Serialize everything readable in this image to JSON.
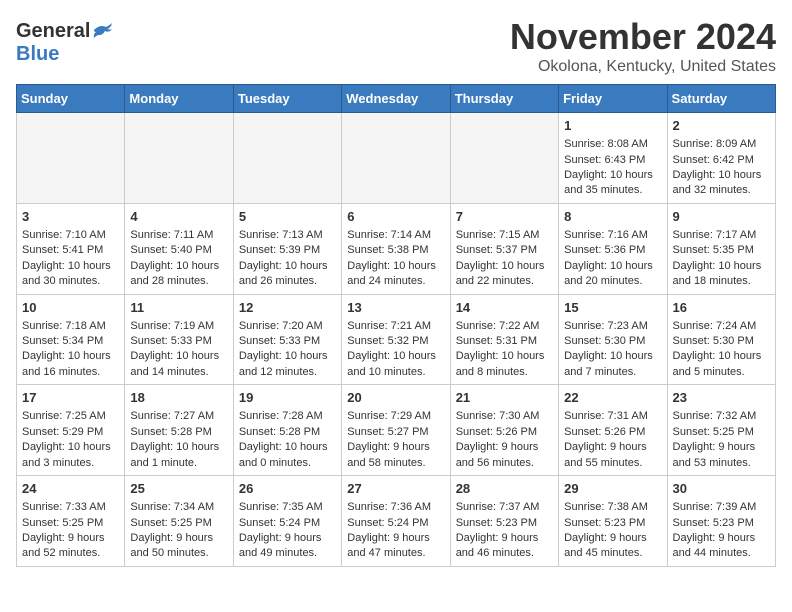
{
  "header": {
    "logo_general": "General",
    "logo_blue": "Blue",
    "month": "November 2024",
    "location": "Okolona, Kentucky, United States"
  },
  "days_of_week": [
    "Sunday",
    "Monday",
    "Tuesday",
    "Wednesday",
    "Thursday",
    "Friday",
    "Saturday"
  ],
  "weeks": [
    [
      {
        "day": "",
        "info": ""
      },
      {
        "day": "",
        "info": ""
      },
      {
        "day": "",
        "info": ""
      },
      {
        "day": "",
        "info": ""
      },
      {
        "day": "",
        "info": ""
      },
      {
        "day": "1",
        "info": "Sunrise: 8:08 AM\nSunset: 6:43 PM\nDaylight: 10 hours and 35 minutes."
      },
      {
        "day": "2",
        "info": "Sunrise: 8:09 AM\nSunset: 6:42 PM\nDaylight: 10 hours and 32 minutes."
      }
    ],
    [
      {
        "day": "3",
        "info": "Sunrise: 7:10 AM\nSunset: 5:41 PM\nDaylight: 10 hours and 30 minutes."
      },
      {
        "day": "4",
        "info": "Sunrise: 7:11 AM\nSunset: 5:40 PM\nDaylight: 10 hours and 28 minutes."
      },
      {
        "day": "5",
        "info": "Sunrise: 7:13 AM\nSunset: 5:39 PM\nDaylight: 10 hours and 26 minutes."
      },
      {
        "day": "6",
        "info": "Sunrise: 7:14 AM\nSunset: 5:38 PM\nDaylight: 10 hours and 24 minutes."
      },
      {
        "day": "7",
        "info": "Sunrise: 7:15 AM\nSunset: 5:37 PM\nDaylight: 10 hours and 22 minutes."
      },
      {
        "day": "8",
        "info": "Sunrise: 7:16 AM\nSunset: 5:36 PM\nDaylight: 10 hours and 20 minutes."
      },
      {
        "day": "9",
        "info": "Sunrise: 7:17 AM\nSunset: 5:35 PM\nDaylight: 10 hours and 18 minutes."
      }
    ],
    [
      {
        "day": "10",
        "info": "Sunrise: 7:18 AM\nSunset: 5:34 PM\nDaylight: 10 hours and 16 minutes."
      },
      {
        "day": "11",
        "info": "Sunrise: 7:19 AM\nSunset: 5:33 PM\nDaylight: 10 hours and 14 minutes."
      },
      {
        "day": "12",
        "info": "Sunrise: 7:20 AM\nSunset: 5:33 PM\nDaylight: 10 hours and 12 minutes."
      },
      {
        "day": "13",
        "info": "Sunrise: 7:21 AM\nSunset: 5:32 PM\nDaylight: 10 hours and 10 minutes."
      },
      {
        "day": "14",
        "info": "Sunrise: 7:22 AM\nSunset: 5:31 PM\nDaylight: 10 hours and 8 minutes."
      },
      {
        "day": "15",
        "info": "Sunrise: 7:23 AM\nSunset: 5:30 PM\nDaylight: 10 hours and 7 minutes."
      },
      {
        "day": "16",
        "info": "Sunrise: 7:24 AM\nSunset: 5:30 PM\nDaylight: 10 hours and 5 minutes."
      }
    ],
    [
      {
        "day": "17",
        "info": "Sunrise: 7:25 AM\nSunset: 5:29 PM\nDaylight: 10 hours and 3 minutes."
      },
      {
        "day": "18",
        "info": "Sunrise: 7:27 AM\nSunset: 5:28 PM\nDaylight: 10 hours and 1 minute."
      },
      {
        "day": "19",
        "info": "Sunrise: 7:28 AM\nSunset: 5:28 PM\nDaylight: 10 hours and 0 minutes."
      },
      {
        "day": "20",
        "info": "Sunrise: 7:29 AM\nSunset: 5:27 PM\nDaylight: 9 hours and 58 minutes."
      },
      {
        "day": "21",
        "info": "Sunrise: 7:30 AM\nSunset: 5:26 PM\nDaylight: 9 hours and 56 minutes."
      },
      {
        "day": "22",
        "info": "Sunrise: 7:31 AM\nSunset: 5:26 PM\nDaylight: 9 hours and 55 minutes."
      },
      {
        "day": "23",
        "info": "Sunrise: 7:32 AM\nSunset: 5:25 PM\nDaylight: 9 hours and 53 minutes."
      }
    ],
    [
      {
        "day": "24",
        "info": "Sunrise: 7:33 AM\nSunset: 5:25 PM\nDaylight: 9 hours and 52 minutes."
      },
      {
        "day": "25",
        "info": "Sunrise: 7:34 AM\nSunset: 5:25 PM\nDaylight: 9 hours and 50 minutes."
      },
      {
        "day": "26",
        "info": "Sunrise: 7:35 AM\nSunset: 5:24 PM\nDaylight: 9 hours and 49 minutes."
      },
      {
        "day": "27",
        "info": "Sunrise: 7:36 AM\nSunset: 5:24 PM\nDaylight: 9 hours and 47 minutes."
      },
      {
        "day": "28",
        "info": "Sunrise: 7:37 AM\nSunset: 5:23 PM\nDaylight: 9 hours and 46 minutes."
      },
      {
        "day": "29",
        "info": "Sunrise: 7:38 AM\nSunset: 5:23 PM\nDaylight: 9 hours and 45 minutes."
      },
      {
        "day": "30",
        "info": "Sunrise: 7:39 AM\nSunset: 5:23 PM\nDaylight: 9 hours and 44 minutes."
      }
    ]
  ]
}
